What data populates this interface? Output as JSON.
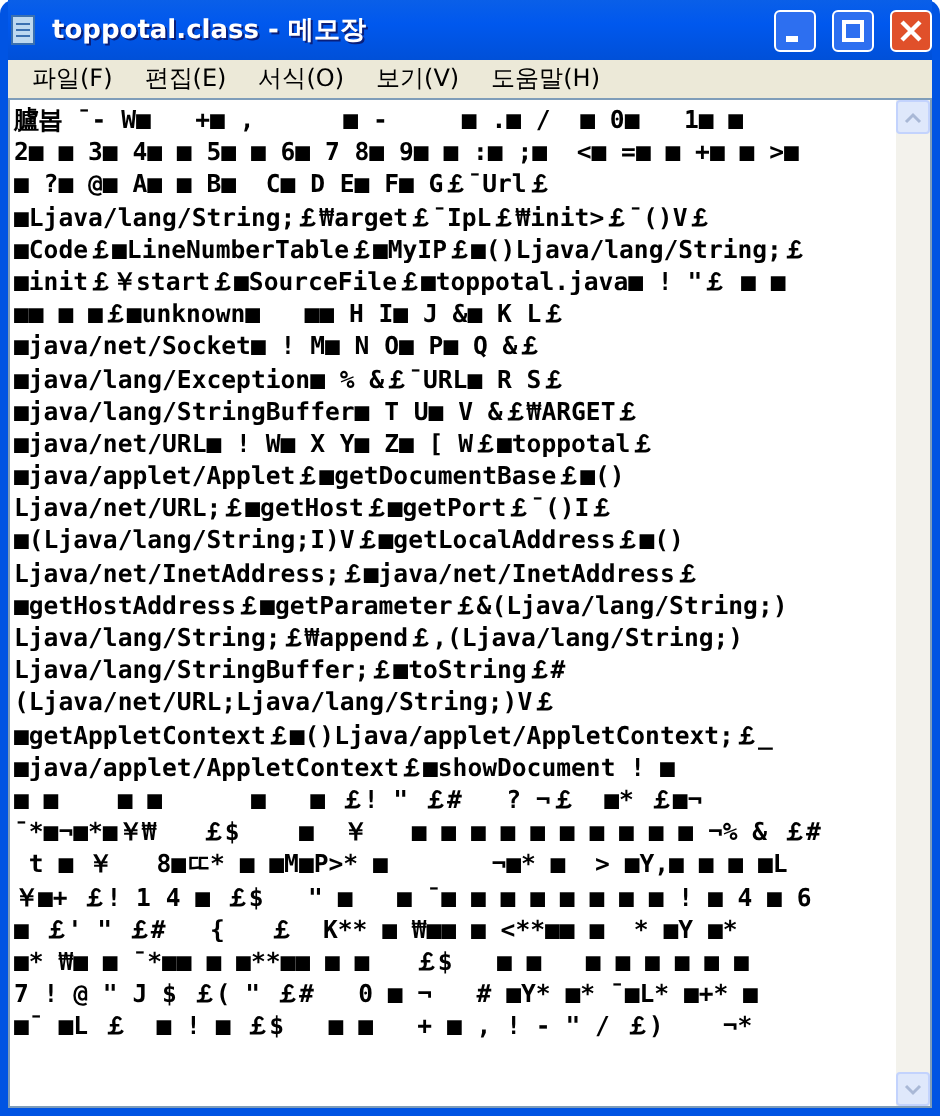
{
  "window": {
    "title": "toppotal.class - 메모장"
  },
  "menu": [
    "파일(F)",
    "편집(E)",
    "서식(O)",
    "보기(V)",
    "도움말(H)"
  ],
  "lines": [
    "臚봅 ¯- W■   +■ ,      ■ -     ■ .■ /  ■ 0■   1■ ■",
    "2■ ■ 3■ 4■ ■ 5■ ■ 6■ 7 8■ 9■ ■ :■ ;■  <■ =■ ■ +■ ■ >■",
    "■ ?■ @■ A■ ■ B■  C■ D E■ F■ G￡¯Url￡",
    "■Ljava/lang/String;￡₩arget￡¯IpL￡₩init>￡¯()V￡",
    "■Code￡■LineNumberTable￡■MyIP￡■()Ljava/lang/String;￡",
    "■init￡￥start￡■SourceFile￡■toppotal.java■ ! \"￡ ■ ■",
    "■■ ■ ■￡■unknown■   ■■ H I■ J &■ K L￡",
    "■java/net/Socket■ ! M■ N O■ P■ Q &￡",
    "■java/lang/Exception■ % &￡¯URL■ R S￡",
    "■java/lang/StringBuffer■ T U■ V &￡₩ARGET￡",
    "■java/net/URL■ ! W■ X Y■ Z■ [ W￡■toppotal￡",
    "■java/applet/Applet￡■getDocumentBase￡■()",
    "Ljava/net/URL;￡■getHost￡■getPort￡¯()I￡",
    "■(Ljava/lang/String;I)V￡■getLocalAddress￡■()",
    "Ljava/net/InetAddress;￡■java/net/InetAddress￡",
    "■getHostAddress￡■getParameter￡&(Ljava/lang/String;)",
    "Ljava/lang/String;￡₩append￡,(Ljava/lang/String;)",
    "Ljava/lang/StringBuffer;￡■toString￡#",
    "(Ljava/net/URL;Ljava/lang/String;)V￡",
    "■getAppletContext￡■()Ljava/applet/AppletContext;￡_",
    "■java/applet/AppletContext￡■showDocument ! ■",
    "■ ■    ■ ■      ■   ■ ￡! \" ￡#   ? ¬￡  ■* ￡■¬",
    "¯*■¬■*■￥₩   ￡$    ■  ￥   ■ ■ ■ ■ ■ ■ ■ ■ ■ ■ ¬% & ￡#",
    " t ■ ￥   8■ㄸ* ■ ■M■P>* ■       ¬■* ■  > ■Y,■ ■ ■ ■L",
    "￥■+ ￡! 1 4 ■ ￡$   \" ■   ■ ¯■ ■ ■ ■ ■ ■ ■ ■ ! ■ 4 ■ 6",
    "■ ￡' \" ￡#   {   ￡  K** ■ ₩■■ ■ <**■■ ■  * ■Y ■*",
    "■* ₩■ ■ ¯*■■ ■ ■**■■ ■ ■   ￡$   ■ ■   ■ ■ ■ ■ ■ ■",
    "7 ! @ \" J $ ￡( \" ￡#   0 ■ ¬   # ■Y* ■* ¯■L* ■+* ■",
    "■¯ ■L ￡  ■ ! ■ ￡$   ■ ■   + ■ , ! - \" / ￡)    ¬*"
  ]
}
